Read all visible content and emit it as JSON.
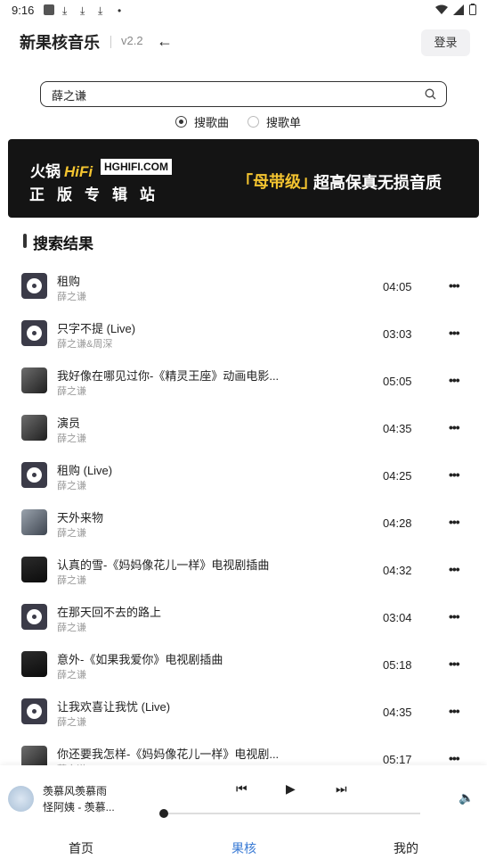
{
  "status": {
    "time": "9:16"
  },
  "header": {
    "title": "新果核音乐",
    "version": "v2.2",
    "login_label": "登录"
  },
  "search": {
    "value": "薛之谦"
  },
  "search_modes": [
    {
      "label": "搜歌曲",
      "selected": true
    },
    {
      "label": "搜歌单",
      "selected": false
    }
  ],
  "banner": {
    "line1": "火锅",
    "line1_highlight": "HiFi",
    "domain": "HGHIFI.COM",
    "line2": "正版专辑站",
    "tag": "「母带级」",
    "slogan": "超高保真无损音质"
  },
  "results": {
    "heading": "搜索结果",
    "songs": [
      {
        "title": "租购",
        "artist": "薛之谦",
        "duration": "04:05",
        "cover": "disc"
      },
      {
        "title": "只字不提 (Live)",
        "artist": "薛之谦&周深",
        "duration": "03:03",
        "cover": "disc"
      },
      {
        "title": "我好像在哪见过你-《精灵王座》动画电影...",
        "artist": "薛之谦",
        "duration": "05:05",
        "cover": "img"
      },
      {
        "title": "演员",
        "artist": "薛之谦",
        "duration": "04:35",
        "cover": "img"
      },
      {
        "title": "租购 (Live)",
        "artist": "薛之谦",
        "duration": "04:25",
        "cover": "disc"
      },
      {
        "title": "天外来物",
        "artist": "薛之谦",
        "duration": "04:28",
        "cover": "img2"
      },
      {
        "title": "认真的雪-《妈妈像花儿一样》电视剧插曲",
        "artist": "薛之谦",
        "duration": "04:32",
        "cover": "img3"
      },
      {
        "title": "在那天回不去的路上",
        "artist": "薛之谦",
        "duration": "03:04",
        "cover": "disc"
      },
      {
        "title": "意外-《如果我爱你》电视剧插曲",
        "artist": "薛之谦",
        "duration": "05:18",
        "cover": "img3"
      },
      {
        "title": "让我欢喜让我忧 (Live)",
        "artist": "薛之谦",
        "duration": "04:35",
        "cover": "disc"
      },
      {
        "title": "你还要我怎样-《妈妈像花儿一样》电视剧...",
        "artist": "薛之谦",
        "duration": "05:17",
        "cover": "img"
      }
    ]
  },
  "player": {
    "title": "羡慕风羡慕雨",
    "artist": "怪阿姨 - 羡慕...",
    "progress": 0.0
  },
  "tabs": [
    {
      "label": "首页",
      "active": false
    },
    {
      "label": "果核",
      "active": true
    },
    {
      "label": "我的",
      "active": false
    }
  ]
}
